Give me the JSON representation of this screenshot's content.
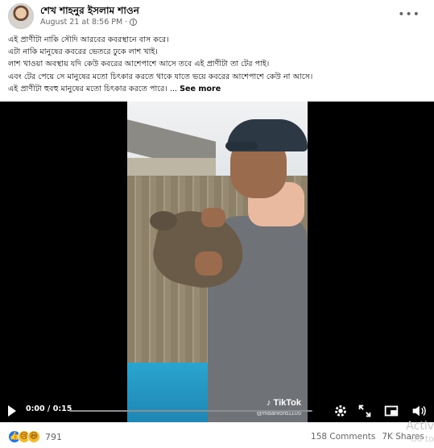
{
  "post": {
    "author": "শেখ শাহনুর ইসলাম শাওন",
    "date": "August 21 at 8:56 PM",
    "privacy_icon": "globe-icon",
    "more_icon": "more-icon"
  },
  "caption": {
    "lines": [
      "এই প্রাণীটা নাকি সৌদি আরবের কবরস্থানে বাস করে।",
      "এটা নাকি মানুষের কবরের ভেতরে ঢুকে লাশ খাই।",
      "লাশ খাওয়া অবস্থায় যদি কেউ কবরের আশেপাশে আসে তবে এই প্রাণীটা তা টের পাই।",
      "এবং টের পেয়ে সে মানুষের মতো চিৎকার করতে থাকে যাতে ভয়ে কবরের আশেপাশে কেউ না আসে।"
    ],
    "last_line": "এই প্রাণীটা হুবহু মানুষের মতো চিৎকার করতে পারে। ...",
    "see_more": "See more"
  },
  "video": {
    "time": "0:00 / 0:15",
    "progress": 0.0,
    "watermark_brand": "♪ TikTok",
    "watermark_user": "@mdanford1105",
    "controls": [
      "play-icon",
      "settings-icon",
      "expand-icon",
      "pip-icon",
      "volume-icon"
    ]
  },
  "footer": {
    "reaction_icons": [
      "like-icon",
      "sad-icon",
      "haha-icon"
    ],
    "reaction_count": "791",
    "comments": "158 Comments",
    "shares": "7K Shares"
  },
  "os_overlay": {
    "line1": "Activ",
    "line2": "Go to"
  }
}
